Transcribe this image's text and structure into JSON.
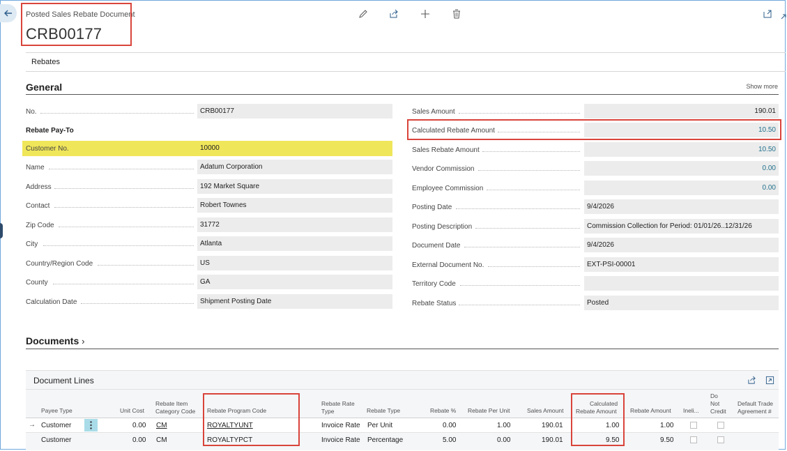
{
  "header": {
    "page_type": "Posted Sales Rebate Document",
    "document_no": "CRB00177",
    "actions": [
      "edit-icon",
      "share-icon",
      "new-icon",
      "delete-icon"
    ]
  },
  "tabs": {
    "rebates": "Rebates"
  },
  "general": {
    "title": "General",
    "show_more": "Show more",
    "left": [
      {
        "label": "No.",
        "value": "CRB00177"
      },
      {
        "label": "Customer No.",
        "value": "10000"
      },
      {
        "label": "Name",
        "value": "Adatum Corporation"
      },
      {
        "label": "Address",
        "value": "192 Market Square"
      },
      {
        "label": "Contact",
        "value": "Robert Townes"
      },
      {
        "label": "Zip Code",
        "value": "31772"
      },
      {
        "label": "City",
        "value": "Atlanta"
      },
      {
        "label": "Country/Region Code",
        "value": "US"
      },
      {
        "label": "County",
        "value": "GA"
      },
      {
        "label": "Calculation Date",
        "value": "Shipment Posting Date"
      }
    ],
    "rebate_pay_to_label": "Rebate Pay-To",
    "right": [
      {
        "label": "Sales Amount",
        "value": "190.01"
      },
      {
        "label": "Calculated Rebate Amount",
        "value": "10.50"
      },
      {
        "label": "Sales Rebate Amount",
        "value": "10.50"
      },
      {
        "label": "Vendor Commission",
        "value": "0.00"
      },
      {
        "label": "Employee Commission",
        "value": "0.00"
      },
      {
        "label": "Posting Date",
        "value": "9/4/2026"
      },
      {
        "label": "Posting Description",
        "value": "Commission Collection for Period: 01/01/26..12/31/26"
      },
      {
        "label": "Document Date",
        "value": "9/4/2026"
      },
      {
        "label": "External Document No.",
        "value": "EXT-PSI-00001"
      },
      {
        "label": "Territory Code",
        "value": ""
      },
      {
        "label": "Rebate Status",
        "value": "Posted"
      }
    ]
  },
  "documents": {
    "title": "Documents"
  },
  "lines": {
    "title": "Document Lines",
    "headers": {
      "payee_type": "Payee Type",
      "unit_cost": "Unit Cost",
      "category_l1": "Rebate Item",
      "category_l2": "Category Code",
      "program_code": "Rebate Program Code",
      "rate_type_l1": "Rebate Rate",
      "rate_type_l2": "Type",
      "rebate_type": "Rebate Type",
      "rebate_pct": "Rebate %",
      "per_unit": "Rebate Per Unit",
      "sales_amount": "Sales Amount",
      "calc_l1": "Calculated",
      "calc_l2": "Rebate Amount",
      "rebate_amount": "Rebate Amount",
      "ineligible": "Ineli...",
      "no_credit_l1": "Do",
      "no_credit_l2": "Not",
      "no_credit_l3": "Credit",
      "trade_l1": "Default Trade",
      "trade_l2": "Agreement #"
    },
    "rows": [
      {
        "payee_type": "Customer",
        "unit_cost": "0.00",
        "category": "CM",
        "program_code": "ROYALTYUNT",
        "rate_type": "Invoice Rate",
        "rebate_type": "Per Unit",
        "rebate_pct": "0.00",
        "per_unit": "1.00",
        "sales_amount": "190.01",
        "calc_amount": "1.00",
        "rebate_amount": "1.00"
      },
      {
        "payee_type": "Customer",
        "unit_cost": "0.00",
        "category": "CM",
        "program_code": "ROYALTYPCT",
        "rate_type": "Invoice Rate",
        "rebate_type": "Percentage",
        "rebate_pct": "5.00",
        "per_unit": "0.00",
        "sales_amount": "190.01",
        "calc_amount": "9.50",
        "rebate_amount": "9.50"
      }
    ]
  },
  "colors": {
    "accent": "#1f6f8b",
    "highlight": "#f0e65a",
    "annotation": "#d9443b"
  }
}
